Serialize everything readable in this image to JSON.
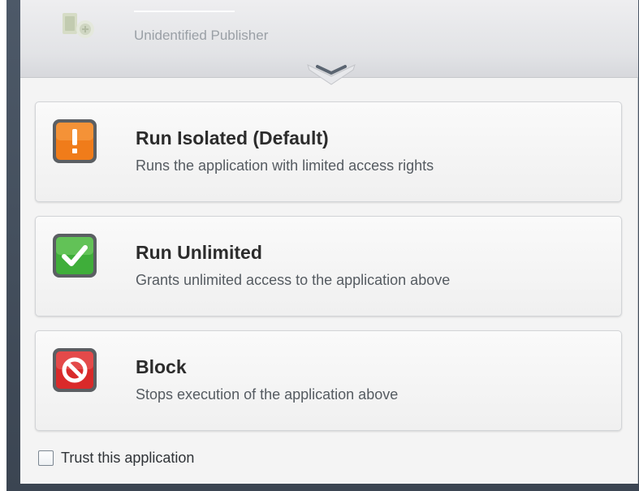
{
  "header": {
    "publisher": "Unidentified Publisher"
  },
  "options": [
    {
      "title": "Run Isolated (Default)",
      "description": "Runs the application with limited access rights",
      "icon": "warning-icon",
      "color": "#f07c1a"
    },
    {
      "title": "Run Unlimited",
      "description": "Grants unlimited access to the application above",
      "icon": "checkmark-icon",
      "color": "#3fae3a"
    },
    {
      "title": "Block",
      "description": "Stops execution of the application above",
      "icon": "block-icon",
      "color": "#d92a2a"
    }
  ],
  "trust": {
    "label": "Trust this application",
    "checked": false
  }
}
